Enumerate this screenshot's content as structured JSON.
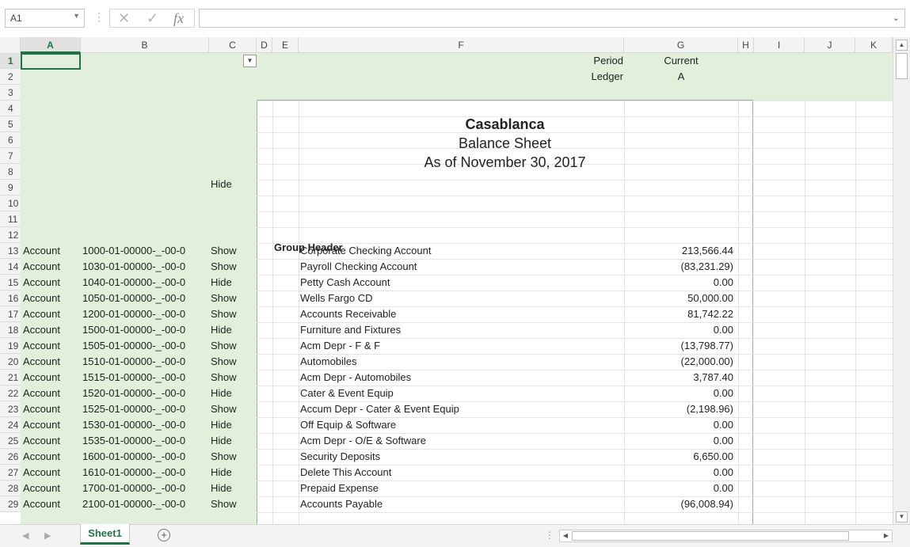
{
  "formula_bar": {
    "name_box": "A1",
    "cancel_icon": "✕",
    "enter_icon": "✓",
    "fx_label": "fx",
    "formula_value": ""
  },
  "columns": [
    "A",
    "B",
    "C",
    "D",
    "E",
    "F",
    "G",
    "H",
    "I",
    "J",
    "K"
  ],
  "header_labels": {
    "period_label": "Period",
    "period_value": "Current",
    "ledger_label": "Ledger",
    "ledger_value": "A"
  },
  "report": {
    "company": "Casablanca",
    "title": "Balance Sheet",
    "date": "As of November 30, 2017",
    "row8_c": "Hide",
    "group_header": "Group Header"
  },
  "rows": [
    {
      "row": 13,
      "a": "Account",
      "b": "1000-01-00000-_-00-0",
      "c": "Show",
      "f": "Corporate Checking Account",
      "g": "213,566.44"
    },
    {
      "row": 14,
      "a": "Account",
      "b": "1030-01-00000-_-00-0",
      "c": "Show",
      "f": "Payroll Checking Account",
      "g": "(83,231.29)"
    },
    {
      "row": 15,
      "a": "Account",
      "b": "1040-01-00000-_-00-0",
      "c": "Hide",
      "f": "Petty Cash Account",
      "g": "0.00"
    },
    {
      "row": 16,
      "a": "Account",
      "b": "1050-01-00000-_-00-0",
      "c": "Show",
      "f": "Wells Fargo CD",
      "g": "50,000.00"
    },
    {
      "row": 17,
      "a": "Account",
      "b": "1200-01-00000-_-00-0",
      "c": "Show",
      "f": "Accounts Receivable",
      "g": "81,742.22"
    },
    {
      "row": 18,
      "a": "Account",
      "b": "1500-01-00000-_-00-0",
      "c": "Hide",
      "f": "Furniture and Fixtures",
      "g": "0.00"
    },
    {
      "row": 19,
      "a": "Account",
      "b": "1505-01-00000-_-00-0",
      "c": "Show",
      "f": "Acm Depr - F & F",
      "g": "(13,798.77)"
    },
    {
      "row": 20,
      "a": "Account",
      "b": "1510-01-00000-_-00-0",
      "c": "Show",
      "f": "Automobiles",
      "g": "(22,000.00)"
    },
    {
      "row": 21,
      "a": "Account",
      "b": "1515-01-00000-_-00-0",
      "c": "Show",
      "f": "Acm Depr - Automobiles",
      "g": "3,787.40"
    },
    {
      "row": 22,
      "a": "Account",
      "b": "1520-01-00000-_-00-0",
      "c": "Hide",
      "f": "Cater & Event Equip",
      "g": "0.00"
    },
    {
      "row": 23,
      "a": "Account",
      "b": "1525-01-00000-_-00-0",
      "c": "Show",
      "f": "Accum Depr - Cater & Event Equip",
      "g": "(2,198.96)"
    },
    {
      "row": 24,
      "a": "Account",
      "b": "1530-01-00000-_-00-0",
      "c": "Hide",
      "f": "Off Equip & Software",
      "g": "0.00"
    },
    {
      "row": 25,
      "a": "Account",
      "b": "1535-01-00000-_-00-0",
      "c": "Hide",
      "f": "Acm Depr - O/E & Software",
      "g": "0.00"
    },
    {
      "row": 26,
      "a": "Account",
      "b": "1600-01-00000-_-00-0",
      "c": "Show",
      "f": "Security Deposits",
      "g": "6,650.00"
    },
    {
      "row": 27,
      "a": "Account",
      "b": "1610-01-00000-_-00-0",
      "c": "Hide",
      "f": "Delete This Account",
      "g": "0.00"
    },
    {
      "row": 28,
      "a": "Account",
      "b": "1700-01-00000-_-00-0",
      "c": "Hide",
      "f": "Prepaid Expense",
      "g": "0.00"
    },
    {
      "row": 29,
      "a": "Account",
      "b": "2100-01-00000-_-00-0",
      "c": "Show",
      "f": "Accounts Payable",
      "g": "(96,008.94)"
    }
  ],
  "sheet_tabs": [
    "Sheet1"
  ],
  "colors": {
    "accent": "#217346",
    "green_fill": "#e2efda"
  }
}
